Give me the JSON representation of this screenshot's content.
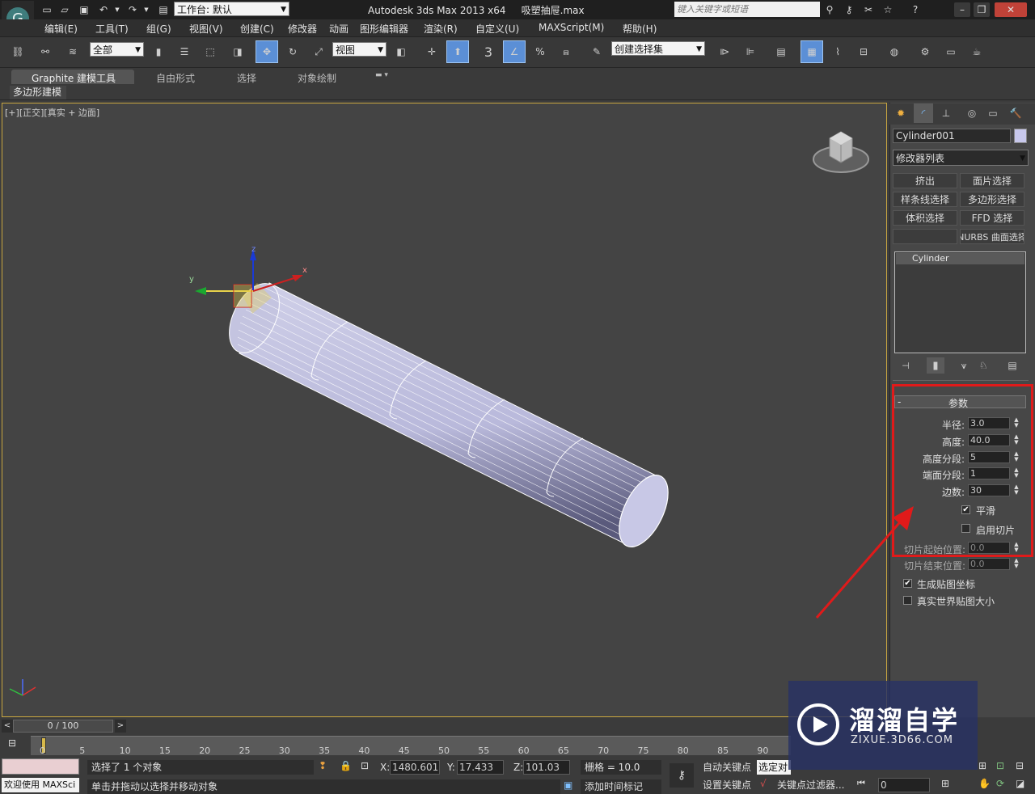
{
  "title_bar": {
    "workspace_label": "工作台: 默认",
    "app_title": "Autodesk 3ds Max  2013 x64",
    "file_name": "吸塑抽屉.max",
    "search_placeholder": "键入关键字或短语"
  },
  "menu": [
    "编辑(E)",
    "工具(T)",
    "组(G)",
    "视图(V)",
    "创建(C)",
    "修改器",
    "动画",
    "图形编辑器",
    "渲染(R)",
    "自定义(U)",
    "MAXScript(M)",
    "帮助(H)"
  ],
  "toolbar": {
    "selection_filter": "全部",
    "ref_coord": "视图",
    "named_selection": "创建选择集",
    "snap_3d": "3"
  },
  "ribbon": {
    "tabs": [
      "Graphite 建模工具",
      "自由形式",
      "选择",
      "对象绘制"
    ],
    "sub_tab": "多边形建模"
  },
  "viewport": {
    "label_bracket1": "[+]",
    "label_view": "[正交]",
    "label_mode": "[真实 + 边面]",
    "axis_x": "x",
    "axis_y": "y",
    "axis_z": "z"
  },
  "command_panel": {
    "object_name": "Cylinder001",
    "modifier_list": "修改器列表",
    "modifier_buttons": [
      "挤出",
      "面片选择",
      "样条线选择",
      "多边形选择",
      "体积选择",
      "FFD 选择",
      "",
      "NURBS 曲面选择"
    ],
    "stack_item": "Cylinder",
    "rollout_title": "参数",
    "rollout_collapse": "-",
    "params": [
      {
        "label": "半径:",
        "value": "3.0"
      },
      {
        "label": "高度:",
        "value": "40.0"
      },
      {
        "label": "高度分段:",
        "value": "5"
      },
      {
        "label": "端面分段:",
        "value": "1"
      },
      {
        "label": "边数:",
        "value": "30"
      }
    ],
    "smooth_label": "平滑",
    "smooth_checked": true,
    "slice_label": "启用切片",
    "slice_checked": false,
    "slice_from_label": "切片起始位置:",
    "slice_from_value": "0.0",
    "slice_to_label": "切片结束位置:",
    "slice_to_value": "0.0",
    "gen_map_label": "生成贴图坐标",
    "gen_map_checked": true,
    "real_world_label": "真实世界贴图大小",
    "real_world_checked": false
  },
  "timeline": {
    "frame_counter": "0 / 100",
    "ticks": [
      "0",
      "5",
      "10",
      "15",
      "20",
      "25",
      "30",
      "35",
      "40",
      "45",
      "50",
      "55",
      "60",
      "65",
      "70",
      "75",
      "80",
      "85",
      "90"
    ]
  },
  "status": {
    "welcome": "欢迎使用 MAXSci",
    "selected": "选择了 1 个对象",
    "prompt": "单击并拖动以选择并移动对象",
    "x_label": "X:",
    "x_value": "1480.601",
    "y_label": "Y:",
    "y_value": "17.433",
    "z_label": "Z:",
    "z_value": "101.03",
    "grid": "栅格 = 10.0",
    "add_time_tag": "添加时间标记",
    "auto_key": "自动关键点",
    "set_key": "设置关键点",
    "selected_dd": "选定对",
    "key_filters": "关键点过滤器...",
    "frame": "0"
  },
  "watermark": {
    "brand": "溜溜自学",
    "url": "ZIXUE.3D66.COM"
  },
  "colors": {
    "annotation_red": "#e01a1a",
    "viewport_bg": "#444444",
    "cylinder_fill": "#c9c9e6",
    "selection_yellow": "#e8d24a"
  }
}
